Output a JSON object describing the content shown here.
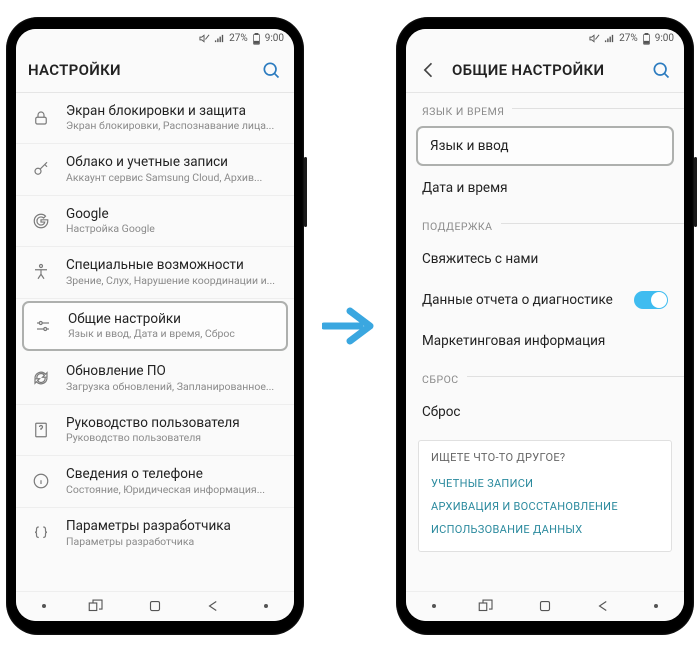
{
  "status": {
    "battery": "27%",
    "time": "9:00"
  },
  "left": {
    "title": "НАСТРОЙКИ",
    "items": [
      {
        "icon": "lock",
        "title": "Экран блокировки и защита",
        "sub": "Экран блокировки, Распознавание лица..."
      },
      {
        "icon": "key",
        "title": "Облако и учетные записи",
        "sub": "Аккаунт сервис Samsung Cloud, Архив..."
      },
      {
        "icon": "google",
        "title": "Google",
        "sub": "Настройка Google"
      },
      {
        "icon": "accessibility",
        "title": "Специальные возможности",
        "sub": "Зрение, Слух, Нарушение координации и..."
      },
      {
        "icon": "sliders",
        "title": "Общие настройки",
        "sub": "Язык и ввод, Дата и время, Сброс",
        "highlight": true
      },
      {
        "icon": "update",
        "title": "Обновление ПО",
        "sub": "Загрузка обновлений, Запланированное..."
      },
      {
        "icon": "manual",
        "title": "Руководство пользователя",
        "sub": "Руководство пользователя"
      },
      {
        "icon": "info",
        "title": "Сведения о телефоне",
        "sub": "Состояние, Юридическая информация..."
      },
      {
        "icon": "braces",
        "title": "Параметры разработчика",
        "sub": "Параметры разработчика"
      }
    ]
  },
  "right": {
    "title": "ОБЩИЕ НАСТРОЙКИ",
    "sections": {
      "langtime": {
        "header": "ЯЗЫК И ВРЕМЯ",
        "lang_input": "Язык и ввод",
        "datetime": "Дата и время"
      },
      "support": {
        "header": "ПОДДЕРЖКА",
        "contact": "Свяжитесь с нами",
        "diag": "Данные отчета о диагностике",
        "marketing": "Маркетинговая информация"
      },
      "reset": {
        "header": "СБРОС",
        "reset": "Сброс"
      }
    },
    "related": {
      "title": "ИЩЕТЕ ЧТО-ТО ДРУГОЕ?",
      "links": [
        "УЧЕТНЫЕ ЗАПИСИ",
        "АРХИВАЦИЯ И ВОССТАНОВЛЕНИЕ",
        "ИСПОЛЬЗОВАНИЕ ДАННЫХ"
      ]
    }
  }
}
